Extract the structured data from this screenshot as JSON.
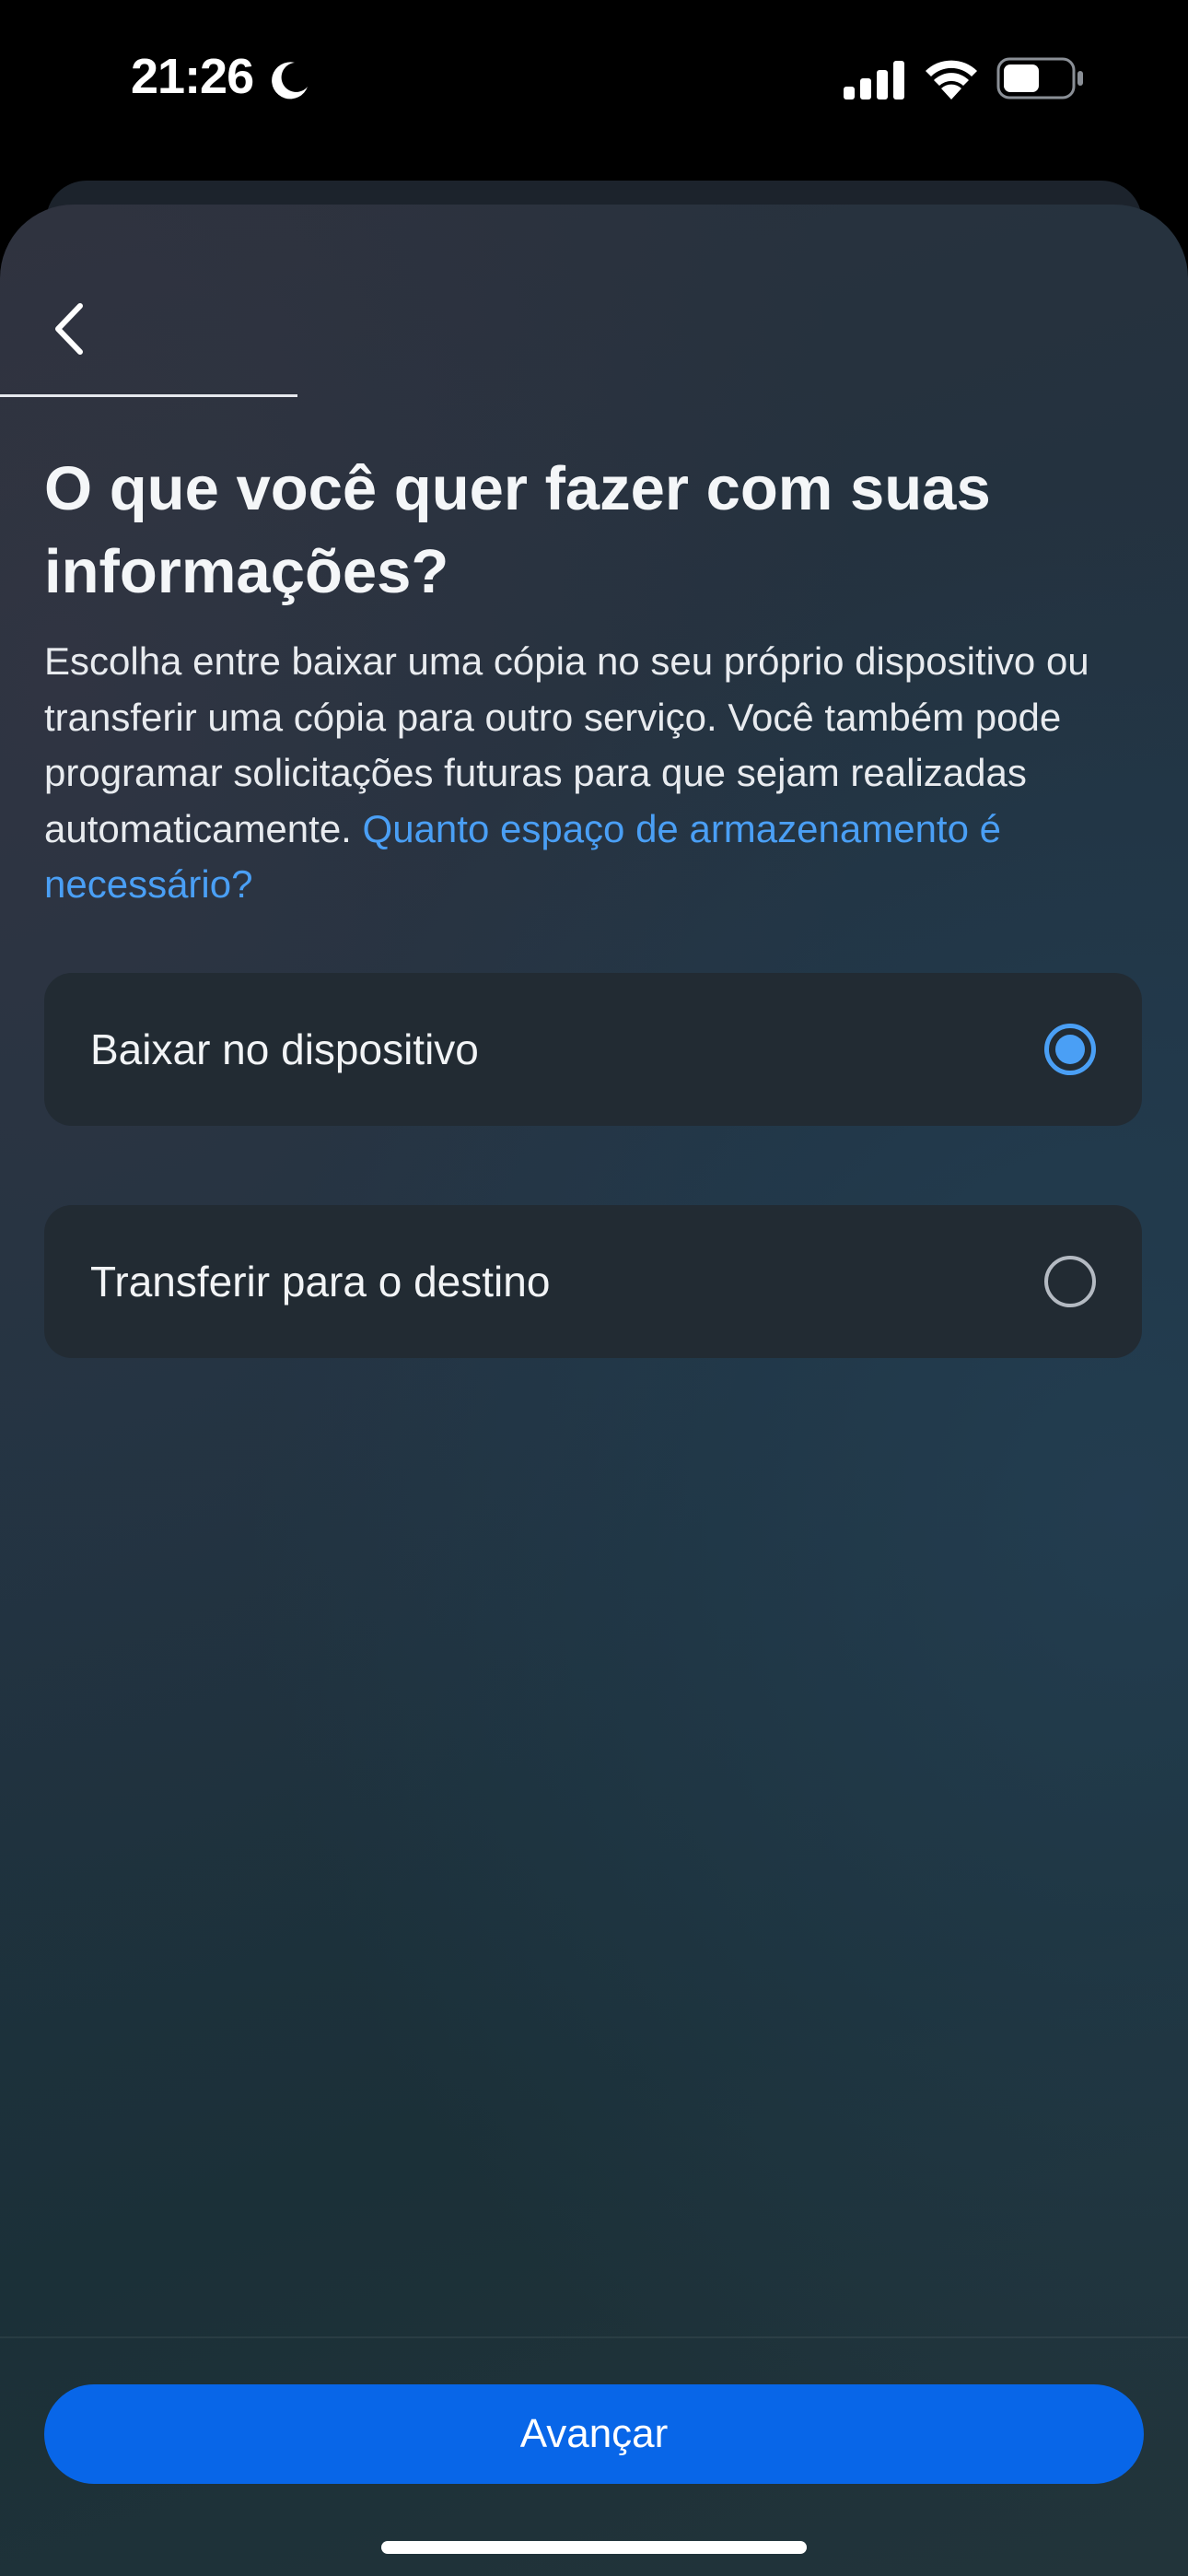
{
  "status_bar": {
    "time": "21:26",
    "icons": [
      "moon-icon",
      "signal-icon",
      "wifi-icon",
      "battery-icon"
    ]
  },
  "header": {
    "back_icon": "chevron-left-icon",
    "progress_fraction": 0.5
  },
  "main": {
    "title": "O que você quer fazer com suas informações?",
    "description": "Escolha entre baixar uma cópia no seu próprio dispositivo ou transferir uma cópia para outro serviço. Você também pode programar solicitações futuras para que sejam realizadas automaticamente.",
    "help_link": "Quanto espaço de armazenamento é necessário?",
    "options": [
      {
        "label": "Baixar no dispositivo",
        "selected": true
      },
      {
        "label": "Transferir para o destino",
        "selected": false
      }
    ]
  },
  "footer": {
    "next_label": "Avançar"
  },
  "colors": {
    "accent": "#4a9ff5",
    "primary_button": "#0866e8",
    "option_bg": "#222b33"
  }
}
